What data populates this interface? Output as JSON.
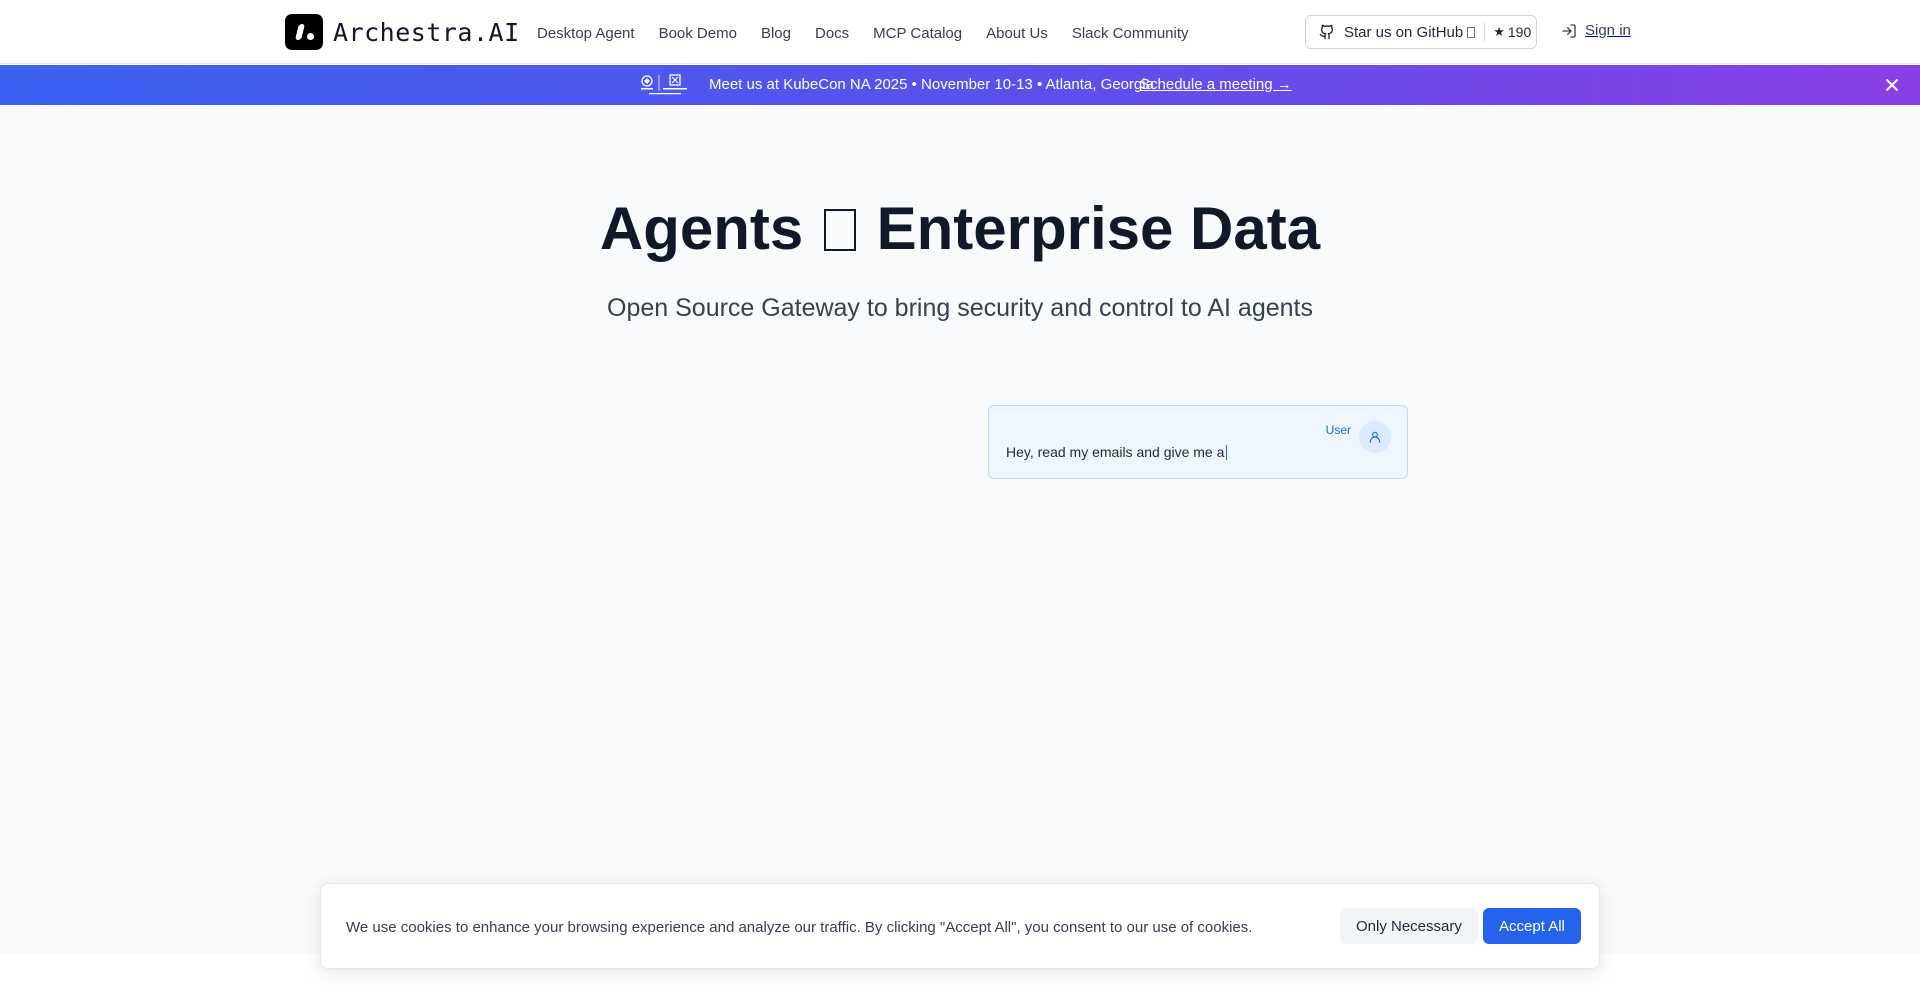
{
  "header": {
    "brand": "Archestra.AI",
    "nav": [
      {
        "label": "Desktop Agent"
      },
      {
        "label": "Book Demo"
      },
      {
        "label": "Blog"
      },
      {
        "label": "Docs"
      },
      {
        "label": "MCP Catalog"
      },
      {
        "label": "About Us"
      },
      {
        "label": "Slack Community"
      }
    ],
    "github": {
      "label": "Star us on GitHub",
      "star_count": "190",
      "icon": "github-icon"
    },
    "signin_label": "Sign in"
  },
  "banner": {
    "text": "Meet us at KubeCon NA 2025 • November 10-13 • Atlanta, Georgia",
    "link": "Schedule a meeting →",
    "gradient": [
      "#3b62f0",
      "#8a3fe6"
    ]
  },
  "hero": {
    "title_left": "Agents",
    "title_right": "Enterprise Data",
    "subtitle": "Open Source Gateway to bring security and control to AI agents"
  },
  "chat": {
    "role": "User",
    "message": "Hey, read my emails and give me a"
  },
  "cookie": {
    "text": "We use cookies to enhance your browsing experience and analyze our traffic. By clicking \"Accept All\", you consent to our use of cookies.",
    "necessary_label": "Only Necessary",
    "accept_label": "Accept All"
  },
  "colors": {
    "accent": "#2563eb",
    "text": "#111827",
    "background": "#f8fafc"
  }
}
